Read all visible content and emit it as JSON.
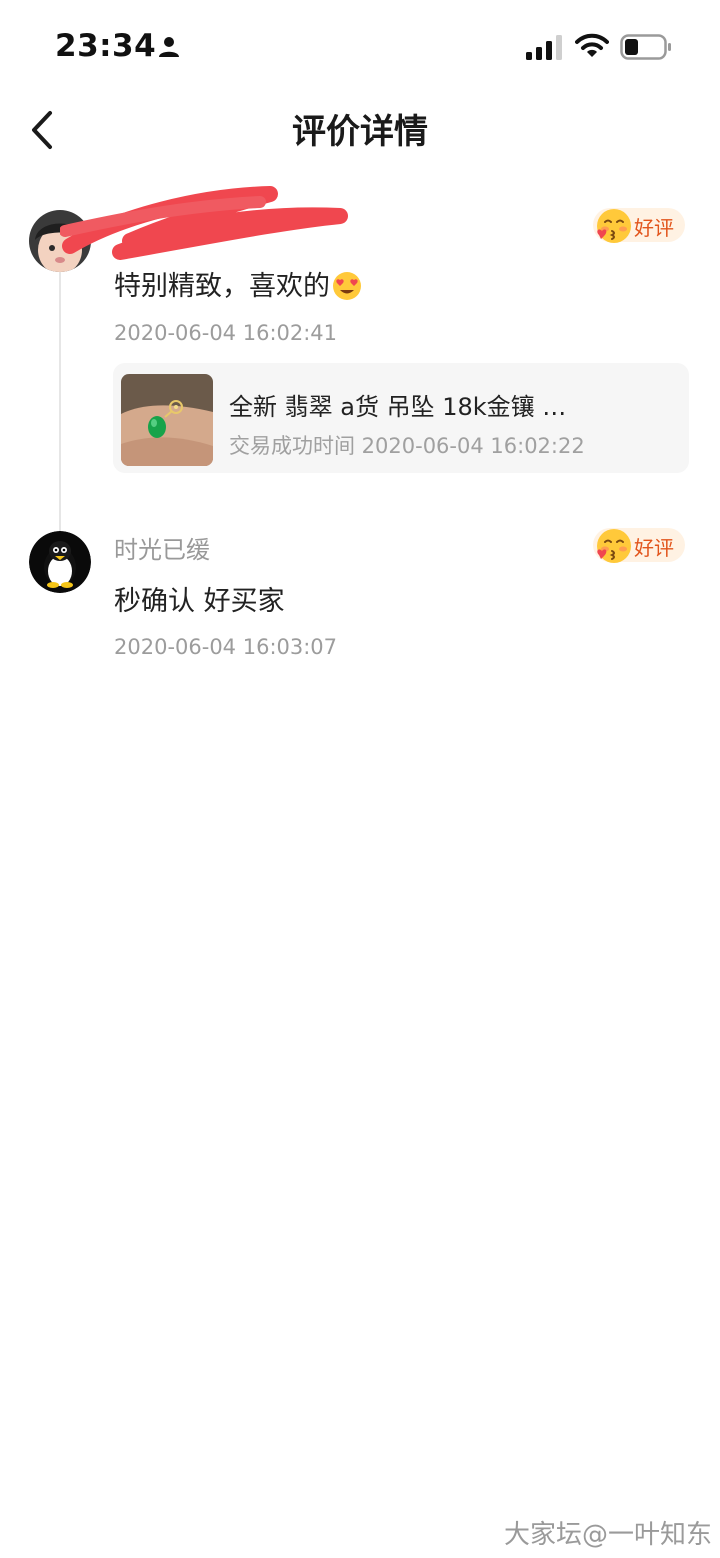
{
  "status_bar": {
    "time": "23:34",
    "icons": [
      "person-icon",
      "signal-icon",
      "wifi-icon",
      "battery-icon"
    ]
  },
  "header": {
    "back_icon": "chevron-left-icon",
    "title": "评价详情"
  },
  "reviews": [
    {
      "username": "",
      "avatar": "baby-photo-avatar",
      "badge": "好评",
      "comment": "特别精致，喜欢的",
      "comment_emoji": "heart-eyes-icon",
      "timestamp": "2020-06-04 16:02:41",
      "product": {
        "title": "全新 翡翠 a货 吊坠  18k金镶 …",
        "date": "交易成功时间 2020-06-04 16:02:22"
      }
    },
    {
      "username": "时光已缓",
      "avatar": "penguin-avatar",
      "badge": "好评",
      "comment": "秒确认 好买家",
      "timestamp": "2020-06-04 16:03:07"
    }
  ],
  "watermark": "大家坛@一叶知东",
  "colors": {
    "badge_bg": "#fff2e3",
    "badge_text": "#e2551c",
    "redaction": "#f0474f"
  }
}
